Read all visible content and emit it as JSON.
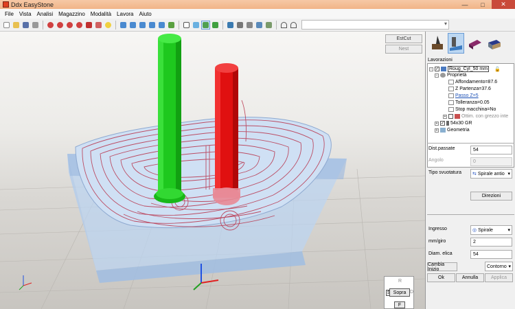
{
  "window": {
    "title": "Ddx EasyStone"
  },
  "menu": [
    "File",
    "Vista",
    "Analisi",
    "Magazzino",
    "Modalità",
    "Lavora",
    "Aiuto"
  ],
  "toolbar": {
    "icons": [
      "new-icon",
      "open-icon",
      "save-icon",
      "print-icon",
      "zoom-window-icon",
      "zoom-in-icon",
      "zoom-out-icon",
      "zoom-all-icon",
      "measure-icon",
      "redraw-icon",
      "bulb-icon",
      "view-top-icon",
      "view-front-icon",
      "view-right-icon",
      "view-left-icon",
      "view-back-icon",
      "view-iso-icon",
      "wireframe-icon",
      "shaded-icon",
      "active-shaded-icon",
      "solid-icon",
      "tool-icon",
      "machine-icon",
      "cut-icon",
      "sim-icon",
      "export-icon",
      "arc-icon",
      "arc2-icon"
    ]
  },
  "viewport": {
    "estcut_label": "EstCut",
    "nest_label": "Nest"
  },
  "navcube": {
    "r": "R",
    "s": "S",
    "top": "Sopra",
    "d": "D",
    "f": "F"
  },
  "panel": {
    "section_label": "Lavorazioni",
    "tree": [
      {
        "text": "Roug_Cyl_50 mm",
        "level": 0,
        "type": "op"
      },
      {
        "text": "Proprietà",
        "level": 1,
        "type": "props"
      },
      {
        "text": "Affondamento=87.6",
        "level": 2,
        "type": "param"
      },
      {
        "text": "Z Partenza=37.6",
        "level": 2,
        "type": "param"
      },
      {
        "text": "Passo Z=5",
        "level": 2,
        "type": "link"
      },
      {
        "text": "Tolleranza=0.05",
        "level": 2,
        "type": "param"
      },
      {
        "text": "Stop macchina=No",
        "level": 2,
        "type": "param"
      },
      {
        "text": "Ottim. con grezzo inte",
        "level": 2,
        "type": "gray"
      },
      {
        "text": "54x30 GR",
        "level": 1,
        "type": "tool"
      },
      {
        "text": "Geometria",
        "level": 1,
        "type": "geo"
      }
    ],
    "dist_passate_label": "Dist.passate",
    "dist_passate_value": "54",
    "angolo_label": "Angolo",
    "angolo_value": "0",
    "tipo_svuotatura_label": "Tipo svuotatura",
    "tipo_svuotatura_value": "Spirale antio",
    "direzioni_label": "Direzioni",
    "ingresso_label": "Ingresso",
    "ingresso_value": "Spirale",
    "mmgiro_label": "mm/giro",
    "mmgiro_value": "2",
    "diam_elica_label": "Diam. elica",
    "diam_elica_value": "54",
    "cambia_inizio_label": "Cambia Inizio",
    "contorno_label": "Contorno",
    "ok_label": "Ok",
    "annulla_label": "Annulla",
    "applica_label": "Applica"
  },
  "colors": {
    "green_tool": "#1ec81e",
    "red_tool": "#e01010",
    "toolpath": "#b8324a",
    "stock": "#a9c6ea"
  }
}
